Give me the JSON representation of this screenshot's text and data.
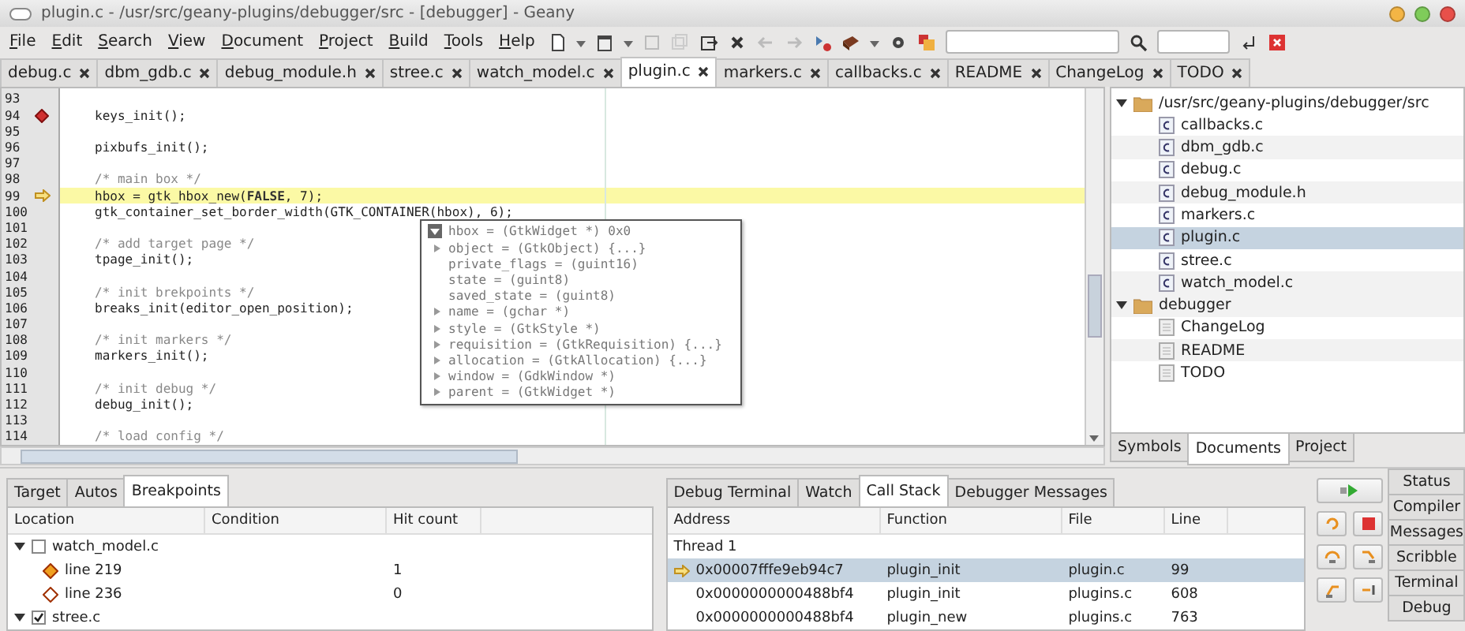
{
  "window": {
    "title": "plugin.c - /usr/src/geany-plugins/debugger/src - [debugger] - Geany"
  },
  "menu": [
    "File",
    "Edit",
    "Search",
    "View",
    "Document",
    "Project",
    "Build",
    "Tools",
    "Help"
  ],
  "tabs": [
    {
      "label": "debug.c",
      "selected": false
    },
    {
      "label": "dbm_gdb.c",
      "selected": false
    },
    {
      "label": "debug_module.h",
      "selected": false
    },
    {
      "label": "stree.c",
      "selected": false
    },
    {
      "label": "watch_model.c",
      "selected": false
    },
    {
      "label": "plugin.c",
      "selected": true
    },
    {
      "label": "markers.c",
      "selected": false
    },
    {
      "label": "callbacks.c",
      "selected": false
    },
    {
      "label": "README",
      "selected": false
    },
    {
      "label": "ChangeLog",
      "selected": false
    },
    {
      "label": "TODO",
      "selected": false
    }
  ],
  "editor": {
    "lines": [
      {
        "number": "93",
        "kind": "blank"
      },
      {
        "number": "94",
        "kind": "code",
        "code": "keys_init();",
        "breakpoint": true
      },
      {
        "number": "95",
        "kind": "blank"
      },
      {
        "number": "96",
        "kind": "code",
        "code": "pixbufs_init();"
      },
      {
        "number": "97",
        "kind": "blank"
      },
      {
        "number": "98",
        "kind": "comment",
        "code": "/* main box */"
      },
      {
        "number": "99",
        "kind": "code",
        "code": "hbox = gtk_hbox_new(**FALSE**, 7);",
        "current": true
      },
      {
        "number": "100",
        "kind": "code",
        "code": "gtk_container_set_border_width(GTK_CONTAINER(hbox), 6);"
      },
      {
        "number": "101",
        "kind": "blank"
      },
      {
        "number": "102",
        "kind": "comment",
        "code": "/* add target page */"
      },
      {
        "number": "103",
        "kind": "code",
        "code": "tpage_init();"
      },
      {
        "number": "104",
        "kind": "blank"
      },
      {
        "number": "105",
        "kind": "comment",
        "code": "/* init brekpoints */"
      },
      {
        "number": "106",
        "kind": "code",
        "code": "breaks_init(editor_open_position);"
      },
      {
        "number": "107",
        "kind": "blank"
      },
      {
        "number": "108",
        "kind": "comment",
        "code": "/* init markers */"
      },
      {
        "number": "109",
        "kind": "code",
        "code": "markers_init();"
      },
      {
        "number": "110",
        "kind": "blank"
      },
      {
        "number": "111",
        "kind": "comment",
        "code": "/* init debug */"
      },
      {
        "number": "112",
        "kind": "code",
        "code": "debug_init();"
      },
      {
        "number": "113",
        "kind": "blank"
      },
      {
        "number": "114",
        "kind": "comment",
        "code": "/* load config */"
      }
    ]
  },
  "tooltip": {
    "title": "hbox = (GtkWidget *) 0x0",
    "expanded": true,
    "items": [
      {
        "text": "object = (GtkObject) {...}",
        "expandable": true
      },
      {
        "text": "private_flags = (guint16)",
        "expandable": false
      },
      {
        "text": "state = (guint8)",
        "expandable": false
      },
      {
        "text": "saved_state = (guint8)",
        "expandable": false
      },
      {
        "text": "name = (gchar *)",
        "expandable": true
      },
      {
        "text": "style = (GtkStyle *)",
        "expandable": true
      },
      {
        "text": "requisition = (GtkRequisition) {...}",
        "expandable": true
      },
      {
        "text": "allocation = (GtkAllocation) {...}",
        "expandable": true
      },
      {
        "text": "window = (GdkWindow *)",
        "expandable": true
      },
      {
        "text": "parent = (GtkWidget *)",
        "expandable": true
      }
    ]
  },
  "sidebar": {
    "tree": [
      {
        "label": "/usr/src/geany-plugins/debugger/src",
        "kind": "folder",
        "expanded": true,
        "children": [
          {
            "label": "callbacks.c",
            "kind": "source",
            "selected": false
          },
          {
            "label": "dbm_gdb.c",
            "kind": "source",
            "selected": false
          },
          {
            "label": "debug.c",
            "kind": "source",
            "selected": false
          },
          {
            "label": "debug_module.h",
            "kind": "source",
            "selected": false
          },
          {
            "label": "markers.c",
            "kind": "source",
            "selected": false
          },
          {
            "label": "plugin.c",
            "kind": "source",
            "selected": true
          },
          {
            "label": "stree.c",
            "kind": "source",
            "selected": false
          },
          {
            "label": "watch_model.c",
            "kind": "source",
            "selected": false
          }
        ]
      },
      {
        "label": "debugger",
        "kind": "folder",
        "expanded": true,
        "children": [
          {
            "label": "ChangeLog",
            "kind": "text",
            "selected": false
          },
          {
            "label": "README",
            "kind": "text",
            "selected": false
          },
          {
            "label": "TODO",
            "kind": "text",
            "selected": false
          }
        ]
      }
    ],
    "tabs": [
      {
        "label": "Symbols",
        "selected": false
      },
      {
        "label": "Documents",
        "selected": true
      },
      {
        "label": "Project",
        "selected": false
      }
    ]
  },
  "breakpoints_panel": {
    "tabs": [
      {
        "label": "Target",
        "selected": false
      },
      {
        "label": "Autos",
        "selected": false
      },
      {
        "label": "Breakpoints",
        "selected": true
      }
    ],
    "columns": [
      "Location",
      "Condition",
      "Hit count"
    ],
    "rows": [
      {
        "kind": "file",
        "location": "watch_model.c",
        "checked": false,
        "expanded": true,
        "children": [
          {
            "kind": "breakpoint",
            "location": "line 219",
            "enabled": true,
            "hit_count": "1"
          },
          {
            "kind": "breakpoint",
            "location": "line 236",
            "enabled": false,
            "hit_count": "0"
          }
        ]
      },
      {
        "kind": "file",
        "location": "stree.c",
        "checked": true,
        "expanded": true
      }
    ]
  },
  "call_stack_panel": {
    "tabs": [
      {
        "label": "Debug Terminal",
        "selected": false
      },
      {
        "label": "Watch",
        "selected": false
      },
      {
        "label": "Call Stack",
        "selected": true
      },
      {
        "label": "Debugger Messages",
        "selected": false
      }
    ],
    "columns": [
      "Address",
      "Function",
      "File",
      "Line"
    ],
    "rows": [
      {
        "kind": "thread",
        "label": "Thread 1"
      },
      {
        "kind": "frame",
        "address": "0x00007fffe9eb94c7",
        "function": "plugin_init",
        "file": "plugin.c",
        "line": "99",
        "selected": true,
        "current": true
      },
      {
        "kind": "frame",
        "address": "0x0000000000488bf4",
        "function": "plugin_init",
        "file": "plugins.c",
        "line": "608",
        "selected": false
      },
      {
        "kind": "frame",
        "address": "0x0000000000488bf4",
        "function": "plugin_new",
        "file": "plugins.c",
        "line": "763",
        "selected": false
      }
    ]
  },
  "side_tabs": [
    "Status",
    "Compiler",
    "Messages",
    "Scribble",
    "Terminal",
    "Debug"
  ]
}
